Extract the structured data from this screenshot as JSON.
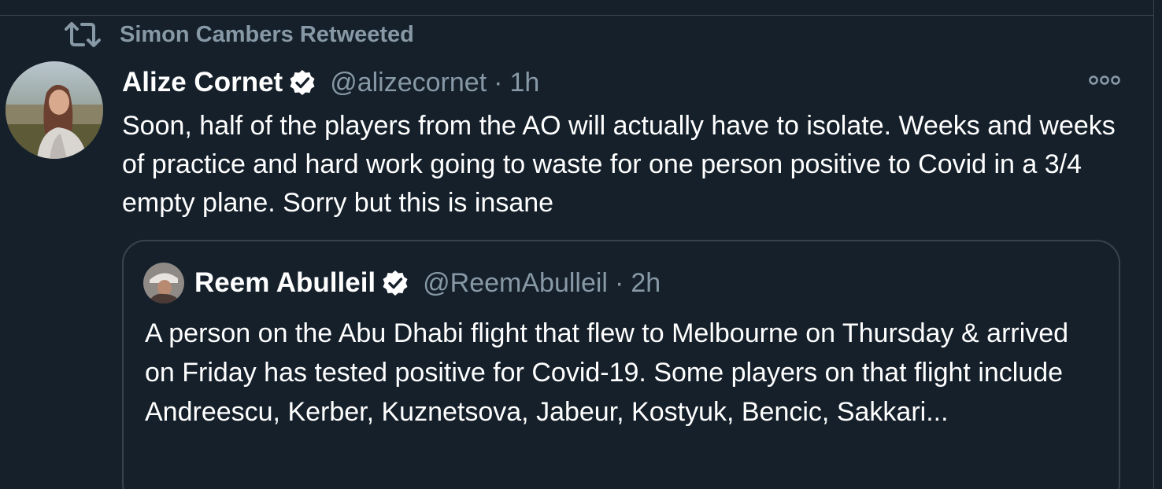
{
  "retweet": {
    "icon": "retweet-icon",
    "label": "Simon Cambers Retweeted"
  },
  "tweet": {
    "author_name": "Alize Cornet",
    "verified": true,
    "handle": "@alizecornet",
    "separator": "·",
    "time": "1h",
    "text": "Soon, half of the players from the AO will actually have to isolate. Weeks and weeks of practice and hard work going to waste for one person positive to Covid in a 3/4 empty plane. Sorry but this is insane",
    "more_icon": "more-options-icon"
  },
  "quoted": {
    "author_name": "Reem Abulleil",
    "verified": true,
    "handle": "@ReemAbulleil",
    "separator": "·",
    "time": "2h",
    "text": "A person on the Abu Dhabi flight that flew to Melbourne on Thursday & arrived on Friday has tested positive for Covid-19. Some players on that flight include Andreescu, Kerber, Kuznetsova, Jabeur, Kostyuk, Bencic, Sakkari..."
  },
  "colors": {
    "background": "#15202b",
    "border": "#38444d",
    "secondary_text": "#8899a6",
    "primary_text": "#ffffff"
  }
}
